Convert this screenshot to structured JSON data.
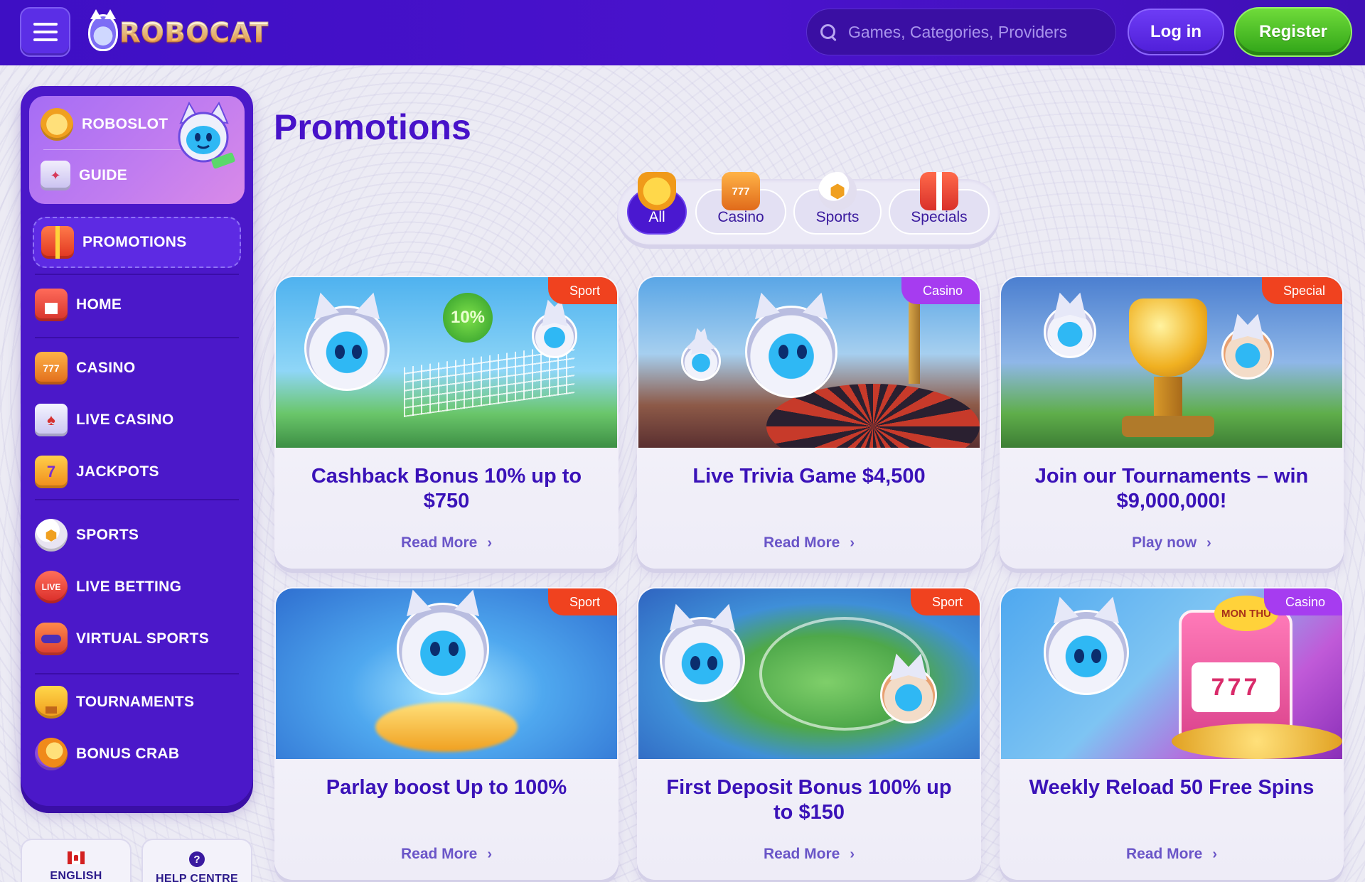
{
  "header": {
    "logo_text": "ROBOCAT",
    "search_placeholder": "Games, Categories, Providers",
    "login_label": "Log in",
    "register_label": "Register"
  },
  "sidebar": {
    "top_items": [
      {
        "label": "ROBOSLOT",
        "icon": "roboslot-coin-icon"
      },
      {
        "label": "GUIDE",
        "icon": "guide-scroll-icon"
      }
    ],
    "active_item": {
      "label": "PROMOTIONS",
      "icon": "gift-icon"
    },
    "items": [
      {
        "label": "HOME",
        "icon": "home-icon"
      },
      {
        "label": "CASINO",
        "icon": "slot-777-icon"
      },
      {
        "label": "LIVE CASINO",
        "icon": "cards-chips-icon"
      },
      {
        "label": "JACKPOTS",
        "icon": "jackpot-7-icon"
      },
      {
        "label": "SPORTS",
        "icon": "soccer-ball-icon"
      },
      {
        "label": "LIVE BETTING",
        "icon": "live-badge-icon"
      },
      {
        "label": "VIRTUAL SPORTS",
        "icon": "vr-headset-icon"
      },
      {
        "label": "TOURNAMENTS",
        "icon": "trophy-icon"
      },
      {
        "label": "BONUS CRAB",
        "icon": "bonus-crab-icon"
      }
    ],
    "footer": {
      "language_label": "ENGLISH",
      "help_label": "HELP CENTRE",
      "help_icon_glyph": "?"
    }
  },
  "main": {
    "title": "Promotions",
    "filters": [
      {
        "label": "All",
        "icon": "trophy-icon",
        "active": true
      },
      {
        "label": "Casino",
        "icon": "slot-777-icon",
        "active": false
      },
      {
        "label": "Sports",
        "icon": "soccer-ball-icon",
        "active": false
      },
      {
        "label": "Specials",
        "icon": "gift-icon",
        "active": false
      }
    ],
    "cards": [
      {
        "badge": "Sport",
        "title": "Cashback Bonus 10% up to $750",
        "link": "Read More",
        "scene_text": "10%"
      },
      {
        "badge": "Casino",
        "title": "Live Trivia Game $4,500",
        "link": "Read More"
      },
      {
        "badge": "Special",
        "title": "Join our Tournaments – win $9,000,000!",
        "link": "Play now"
      },
      {
        "badge": "Sport",
        "title": "Parlay boost Up to 100%",
        "link": "Read More"
      },
      {
        "badge": "Sport",
        "title": "First Deposit Bonus 100% up to $150",
        "link": "Read More"
      },
      {
        "badge": "Casino",
        "title": "Weekly Reload 50 Free Spins",
        "link": "Read More",
        "scene_text": "MON THU"
      }
    ]
  },
  "colors": {
    "header_bg": "#4a12cc",
    "sidebar_bg": "#4b18c9",
    "accent_purple": "#4712c9",
    "register_green": "#2fa317",
    "badge_sport": "#f0421f",
    "badge_casino": "#a63cf0"
  }
}
